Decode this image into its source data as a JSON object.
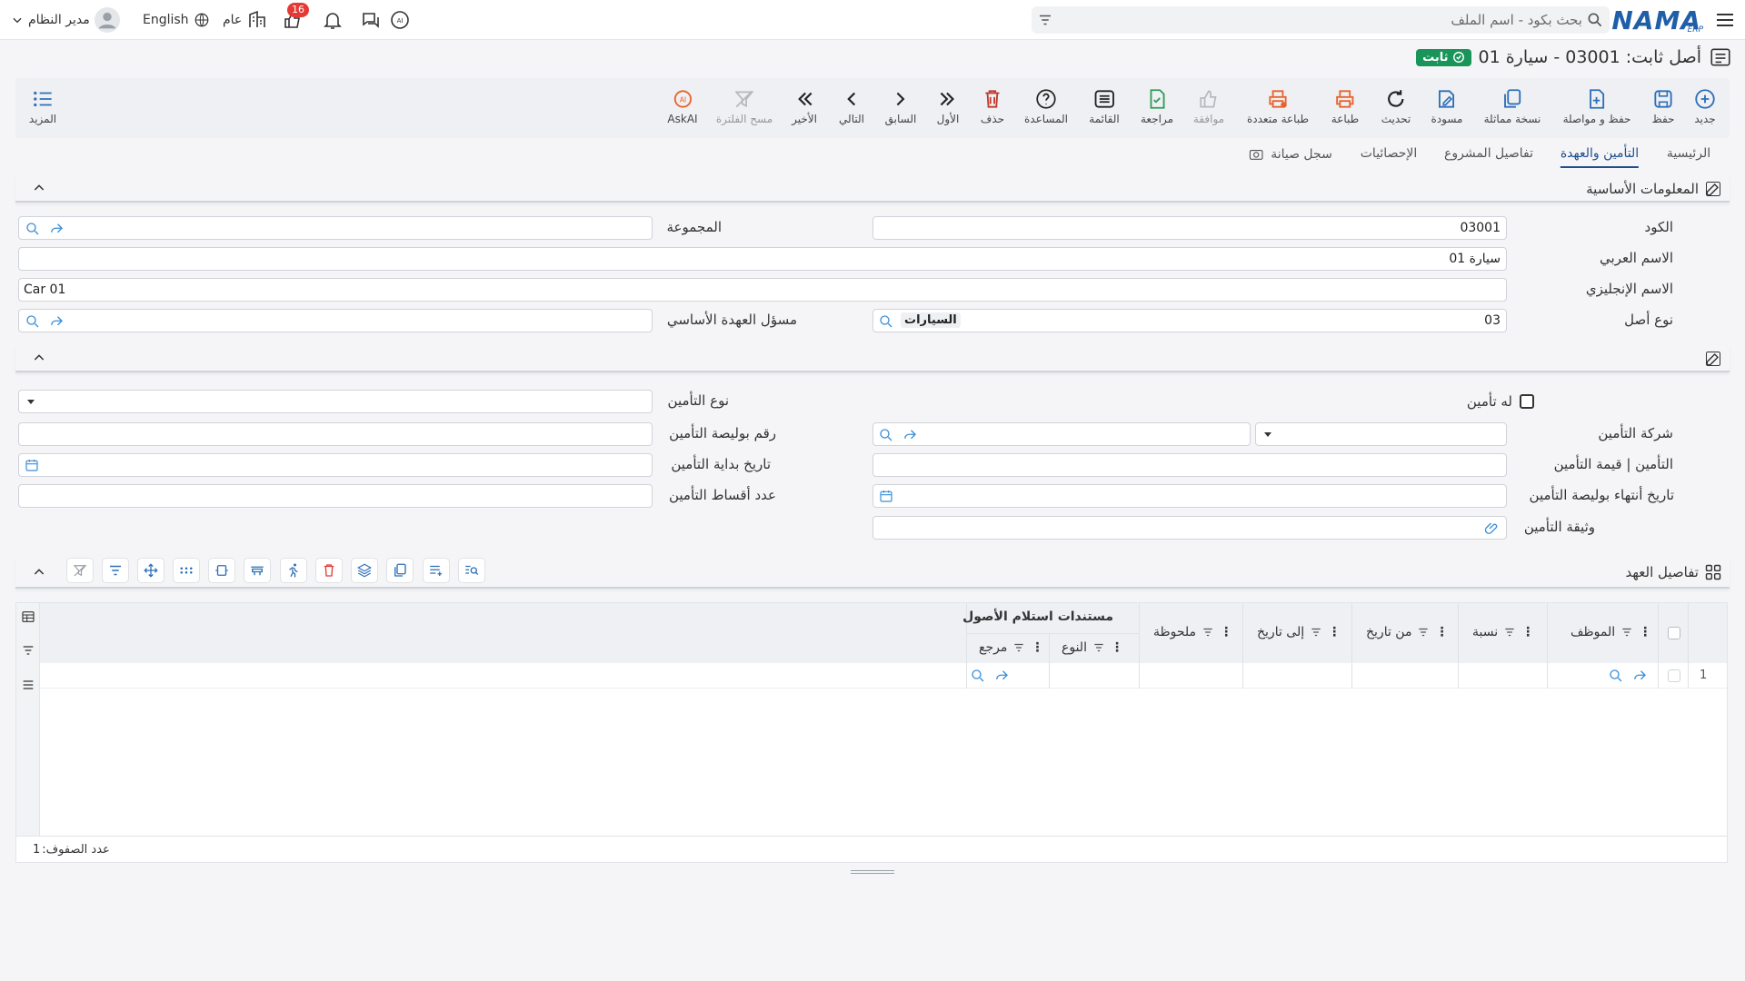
{
  "topbar": {
    "logo_text": "NAMA",
    "logo_sub": "ERP",
    "search_placeholder": "بحث بكود - اسم الملف",
    "language": "English",
    "notifications_count": "16",
    "scope": "عام",
    "user": "مدير النظام"
  },
  "page": {
    "title": "أصل ثابت: 03001 - سيارة 01",
    "status": "ثابت"
  },
  "toolbar": {
    "items": [
      {
        "label": "جديد",
        "icon": "plus-circle-icon"
      },
      {
        "label": "حفظ",
        "icon": "save-icon"
      },
      {
        "label": "حفظ و مواصلة",
        "icon": "save-continue-icon"
      },
      {
        "label": "نسخة مماثلة",
        "icon": "copy-icon"
      },
      {
        "label": "مسودة",
        "icon": "draft-icon"
      },
      {
        "label": "تحديث",
        "icon": "refresh-icon"
      },
      {
        "label": "طباعة",
        "icon": "printer-icon"
      },
      {
        "label": "طباعة متعددة",
        "icon": "multi-print-icon"
      },
      {
        "label": "موافقة",
        "icon": "thumb-up-icon"
      },
      {
        "label": "مراجعة",
        "icon": "review-icon"
      },
      {
        "label": "القائمة",
        "icon": "list-icon"
      },
      {
        "label": "المساعدة",
        "icon": "help-icon"
      },
      {
        "label": "حذف",
        "icon": "trash-icon"
      },
      {
        "label": "الأول",
        "icon": "first-icon"
      },
      {
        "label": "السابق",
        "icon": "previous-icon"
      },
      {
        "label": "التالي",
        "icon": "next-icon"
      },
      {
        "label": "الأخير",
        "icon": "last-icon"
      },
      {
        "label": "مسح الفلترة",
        "icon": "clear-filter-icon"
      },
      {
        "label": "AskAI",
        "icon": "ai-icon"
      }
    ],
    "more_label": "المزيد"
  },
  "tabs": [
    "الرئيسية",
    "التأمين والعهدة",
    "تفاصيل المشروع",
    "الإحصائيات",
    "سجل صيانة"
  ],
  "basic_info": {
    "section_title": "المعلومات الأساسية",
    "code_label": "الكود",
    "code_value": "03001",
    "group_label": "المجموعة",
    "arabic_name_label": "الاسم العربي",
    "arabic_name_value": "سيارة 01",
    "english_name_label": "الاسم الإنجليزي",
    "english_name_value": "Car 01",
    "asset_type_label": "نوع أصل",
    "asset_type_code": "03",
    "asset_type_name": "السيارات",
    "custody_owner_label": "مسؤل العهدة الأساسي"
  },
  "insurance": {
    "has_insurance_label": "له تأمين",
    "insurance_type_label": "نوع التأمين",
    "company_label": "شركة التأمين",
    "policy_number_label": "رقم بوليصة التأمين",
    "value_label": "التأمين | قيمة التأمين",
    "start_date_label": "تاريخ بداية التأمين",
    "end_date_label": "تاريخ أنتهاء بوليصة التأمين",
    "installments_label": "عدد أقساط التأمين",
    "document_label": "وثيقة التأمين"
  },
  "custody": {
    "section_title": "تفاصيل العهد",
    "group_header": "مستندات استلام الأصول",
    "columns": [
      "الموظف",
      "نسبة",
      "من تاريخ",
      "إلى تاريخ",
      "ملحوظة",
      "النوع",
      "مرجع"
    ],
    "row_number": "1",
    "rows_count_label": "عدد الصفوف:",
    "rows_count": "1"
  },
  "colors": {
    "accent": "#1f4e8c",
    "status": "#19955a",
    "toolbar_icon": "#2d6fb8",
    "print_icon": "#e8632c",
    "green_icon": "#2e9d57",
    "delete_icon": "#c0392b"
  }
}
